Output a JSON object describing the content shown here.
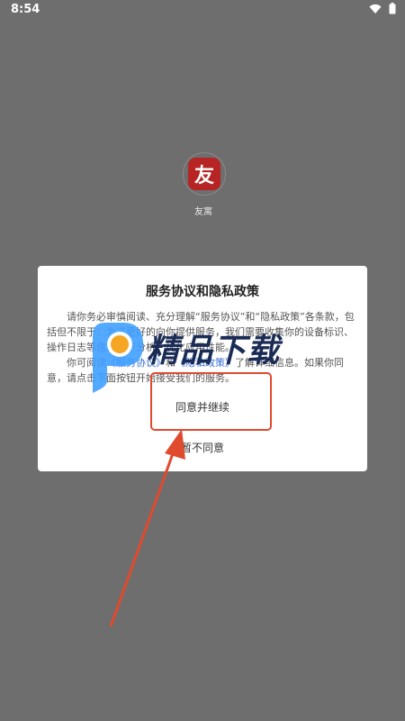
{
  "status_bar": {
    "time": "8:54",
    "icons": [
      "wifi-icon",
      "battery-icon"
    ]
  },
  "app": {
    "icon_char": "友",
    "name": "友寓"
  },
  "dialog": {
    "title": "服务协议和隐私政策",
    "para1": "请你务必审慎阅读、充分理解“服务协议”和“隐私政策”各条款，包括但不限于：为了更好的向你提供服务，我们需要收集你的设备标识、操作日志等信息用于分析、优化应用性能。",
    "para2_before": "你可阅读",
    "para2_link1": "《服务协议》",
    "para2_mid": "和",
    "para2_link2": "《隐私政策》",
    "para2_after": "了解详细信息。如果你同意，请点击下面按钮开始接受我们的服务。",
    "agree_label": "同意并继续",
    "disagree_label": "暂不同意"
  },
  "watermark": {
    "text": "精品下载"
  },
  "colors": {
    "background": "#6e6e6e",
    "dialog": "#ffffff",
    "accent_red": "#e04a2e",
    "link_blue": "#3a6fd8",
    "watermark_blue": "#3fa0ff",
    "watermark_orange": "#f5a623"
  }
}
